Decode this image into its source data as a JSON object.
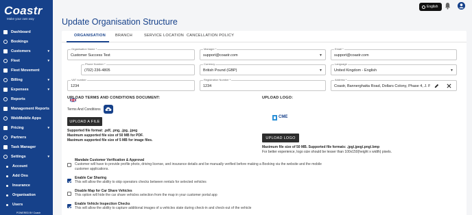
{
  "brand": {
    "logo_text": "Coastr",
    "tagline": "Make your own way",
    "powered_by": "POWERED BY Coastr"
  },
  "sidebar": {
    "items": [
      {
        "label": "Dashboard",
        "icon": "dashboard-icon",
        "chevron": false
      },
      {
        "label": "Bookings",
        "icon": "bookings-icon",
        "chevron": false
      },
      {
        "label": "Customers",
        "icon": "customers-icon",
        "chevron": true
      },
      {
        "label": "Fleet",
        "icon": "car-icon",
        "chevron": true
      },
      {
        "label": "Fleet Movement",
        "icon": "fleet-movement-icon",
        "chevron": false
      },
      {
        "label": "Billing",
        "icon": "billing-icon",
        "chevron": true
      },
      {
        "label": "Expenses",
        "icon": "expenses-icon",
        "chevron": true
      },
      {
        "label": "Reports",
        "icon": "reports-icon",
        "chevron": false
      },
      {
        "label": "Management Reports",
        "icon": "management-reports-icon",
        "chevron": false
      },
      {
        "label": "WebMobile Apps",
        "icon": "webmobile-apps-icon",
        "chevron": false
      },
      {
        "label": "Pricing",
        "icon": "pricing-icon",
        "chevron": true
      },
      {
        "label": "Partners",
        "icon": "partners-icon",
        "chevron": false
      },
      {
        "label": "Task Manager",
        "icon": "task-manager-icon",
        "chevron": false
      },
      {
        "label": "Settings",
        "icon": "gear-icon",
        "chevron": true
      }
    ],
    "sub_items": [
      "Account",
      "Add Ons",
      "Insurance",
      "Organisation",
      "Users"
    ]
  },
  "topbar": {
    "language": "English"
  },
  "page": {
    "title": "Update Organisation Structure"
  },
  "tabs": [
    "ORGANISATION",
    "BRANCH",
    "SERVICE LOCATION",
    "CANCELLATION POLICY"
  ],
  "form": {
    "org_name": {
      "label": "Organisation Name *",
      "value": "Customer Success Test"
    },
    "manager": {
      "label": "Manager *",
      "value": "support@coastr.com"
    },
    "email": {
      "label": "Email *",
      "value": "support@coastr.com"
    },
    "phone": {
      "label": "Phone Number *",
      "value": "(702) 236-4805"
    },
    "currency": {
      "label": "Currency",
      "value": "British Pound (GBP)"
    },
    "language": {
      "label": "Language",
      "value": "United Kingdom - English"
    },
    "vat": {
      "label": "VAT number",
      "value": "1234"
    },
    "registration": {
      "label": "Registration Number *",
      "value": "1234"
    },
    "address": {
      "label": "Address *",
      "value": "Coastr, Bannerghatta Road, Dollars Colony, Phase 4, J. P. N"
    }
  },
  "upload_terms": {
    "title": "UPLOAD TERMS AND CONDITIONS DOCUMENT:",
    "label": "Terms And Conditions",
    "button": "UPLOAD A FILE",
    "formats": "Supported file format: .pdf, .png, .jpg, .jpeg",
    "max_pdf": "Maximum supported file size of 50 MB for PDF.",
    "max_image": "Maximum supported file size of 5 MB for image files."
  },
  "upload_logo": {
    "title": "UPLOAD LOGO:",
    "logo_text": "CME",
    "button": "UPLOAD LOGO",
    "max": "Maximum file size of 50 MB. Supported file formats: .jpg/.jpeg/.png/.bmp",
    "hint": "For better experience, logo size should be lesser than 100x150(height x width) pixels."
  },
  "checkboxes": [
    {
      "title": "Mandate Customer Verification & Approval",
      "desc": "Customer will have to provide profile photo, driving license, and insurance details and be manually verified before making a Booking via the website and the mobile customer applications.",
      "checked": false
    },
    {
      "title": "Enable Car Sharing",
      "desc": "This will allow the ability to skip operators checks between rentals for selected vehicles",
      "checked": true
    },
    {
      "title": "Disable Map for Car Share Vehicles",
      "desc": "This option will hide the car share vehicles selection from the map in your customer portal app",
      "checked": false
    },
    {
      "title": "Enable Vehicle Inspection Checks",
      "desc": "This will allow the ability to capture additional images of a vehicles state during check-in and check-out of the vehicle",
      "checked": true
    }
  ]
}
